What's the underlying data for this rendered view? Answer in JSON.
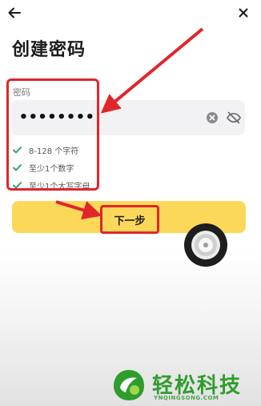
{
  "header": {
    "back_icon": "arrow-left-icon",
    "close_icon": "close-icon"
  },
  "page": {
    "title": "创建密码"
  },
  "password": {
    "label": "密码",
    "value": "••••••••",
    "clear_icon": "clear-circle-icon",
    "visibility_icon": "eye-off-icon"
  },
  "rules": [
    {
      "text": "8-128 个字符",
      "status": "met",
      "icon": "check-icon"
    },
    {
      "text": "至少1个数字",
      "status": "met",
      "icon": "check-icon"
    },
    {
      "text": "至少1个大写字母",
      "status": "met",
      "icon": "check-icon"
    }
  ],
  "actions": {
    "next_label": "下一步"
  },
  "watermark": {
    "title": "轻松科技",
    "subtitle": "YNQINGSONG.COM"
  },
  "colors": {
    "accent": "#fbd85a",
    "check": "#3aa372",
    "annotation": "#e0262b",
    "brand": "#2f9c2e"
  }
}
